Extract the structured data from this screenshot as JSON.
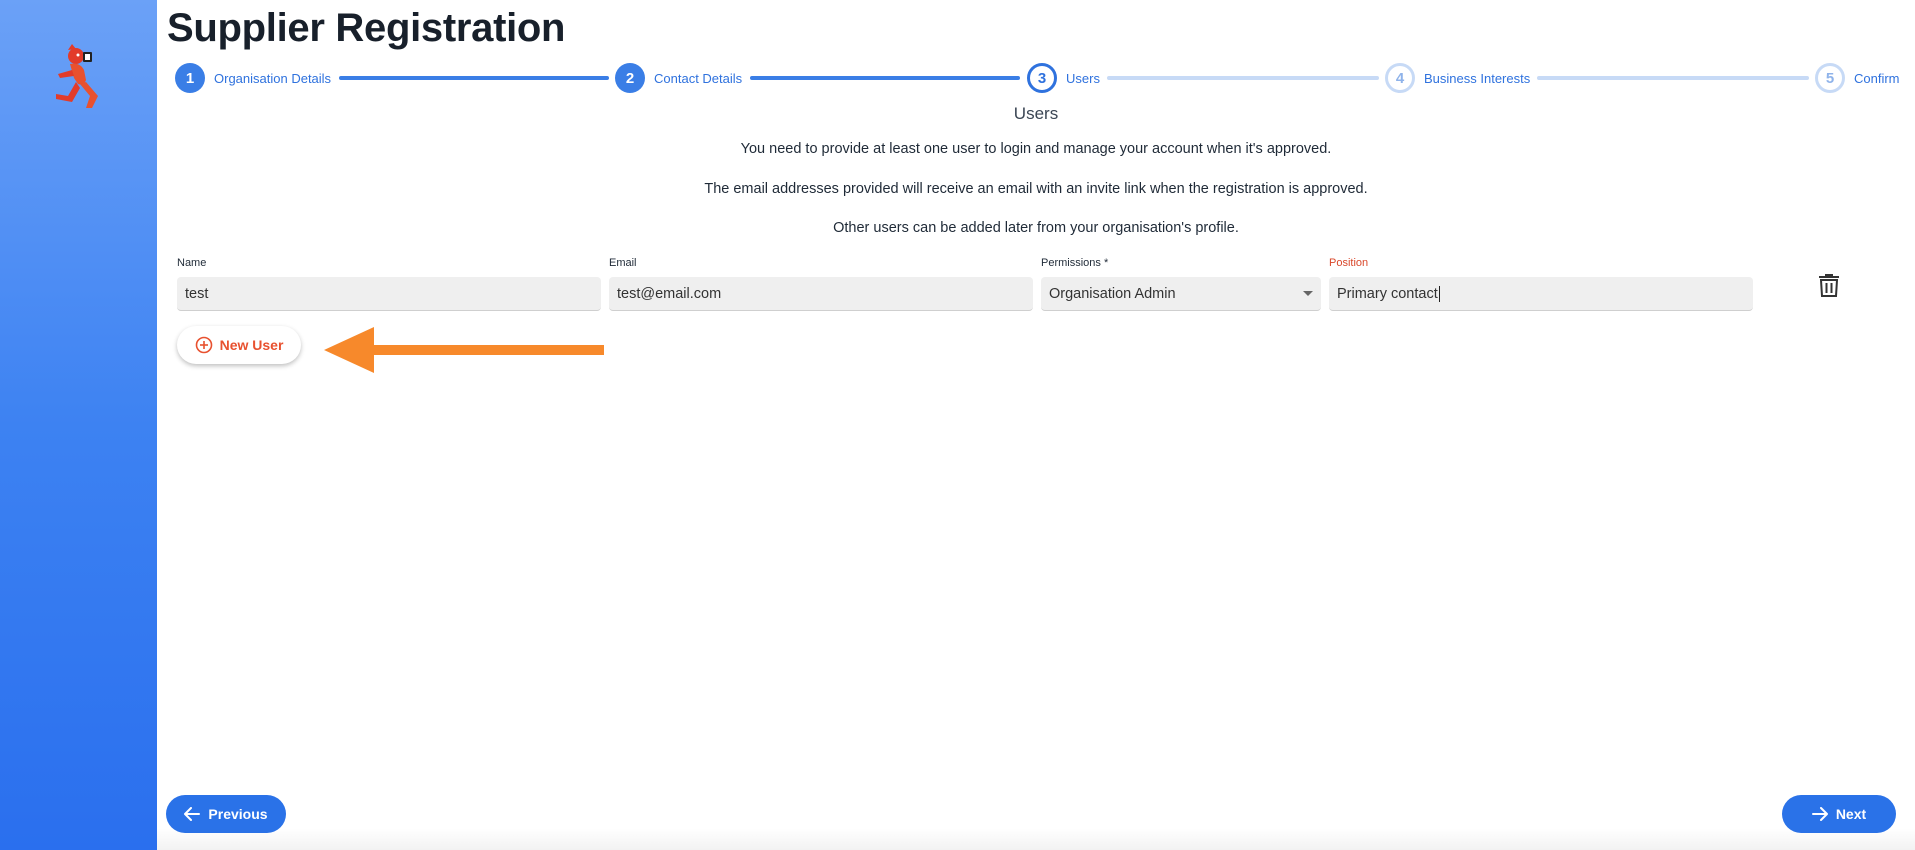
{
  "page": {
    "title": "Supplier Registration"
  },
  "stepper": {
    "steps": [
      {
        "number": "1",
        "label": "Organisation Details",
        "state": "done"
      },
      {
        "number": "2",
        "label": "Contact Details",
        "state": "done"
      },
      {
        "number": "3",
        "label": "Users",
        "state": "active"
      },
      {
        "number": "4",
        "label": "Business Interests",
        "state": "todo"
      },
      {
        "number": "5",
        "label": "Confirm",
        "state": "todo"
      }
    ]
  },
  "section": {
    "title": "Users",
    "info": [
      "You need to provide at least one user to login and manage your account when it's approved.",
      "The email addresses provided will receive an email with an invite link when the registration is approved.",
      "Other users can be added later from your organisation's profile."
    ]
  },
  "user_row": {
    "name_label": "Name",
    "name_value": "test",
    "email_label": "Email",
    "email_value": "test@email.com",
    "permissions_label": "Permissions *",
    "permissions_value": "Organisation Admin",
    "position_label": "Position",
    "position_value": "Primary contact"
  },
  "actions": {
    "new_user_label": "New User",
    "previous_label": "Previous",
    "next_label": "Next"
  },
  "colors": {
    "primary": "#2a72e8",
    "accent": "#e8512f",
    "annotation_arrow": "#f7892b",
    "error_label": "#d9482b"
  },
  "icons": {
    "logo": "mascot-logo-icon",
    "add": "plus-circle-icon",
    "delete": "trash-icon",
    "previous": "arrow-left-icon",
    "next": "arrow-right-icon",
    "annotation": "orange-arrow-annotation"
  }
}
